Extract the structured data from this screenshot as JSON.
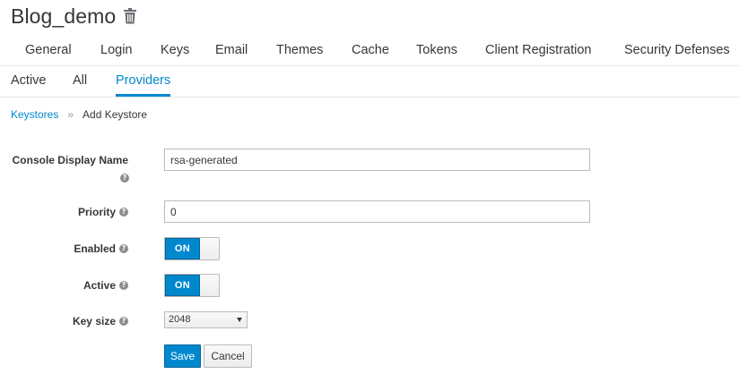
{
  "realm": {
    "title": "Blog_demo",
    "delete_icon": "trash-icon"
  },
  "main_tabs": [
    {
      "label": "General"
    },
    {
      "label": "Login"
    },
    {
      "label": "Keys"
    },
    {
      "label": "Email"
    },
    {
      "label": "Themes"
    },
    {
      "label": "Cache"
    },
    {
      "label": "Tokens"
    },
    {
      "label": "Client Registration"
    },
    {
      "label": "Security Defenses"
    }
  ],
  "sub_tabs": [
    {
      "label": "Active"
    },
    {
      "label": "All"
    },
    {
      "label": "Providers",
      "active": true
    }
  ],
  "breadcrumb": {
    "parent": "Keystores",
    "separator": "»",
    "current": "Add Keystore"
  },
  "form": {
    "display_name": {
      "label": "Console Display Name",
      "value": "rsa-generated"
    },
    "priority": {
      "label": "Priority",
      "value": "0"
    },
    "enabled": {
      "label": "Enabled",
      "state": "ON"
    },
    "active": {
      "label": "Active",
      "state": "ON"
    },
    "key_size": {
      "label": "Key size",
      "selected": "2048"
    },
    "help_glyph": "?",
    "save_label": "Save",
    "cancel_label": "Cancel"
  },
  "colors": {
    "accent": "#0088ce",
    "text": "#363636",
    "border": "#bbbbbb"
  }
}
